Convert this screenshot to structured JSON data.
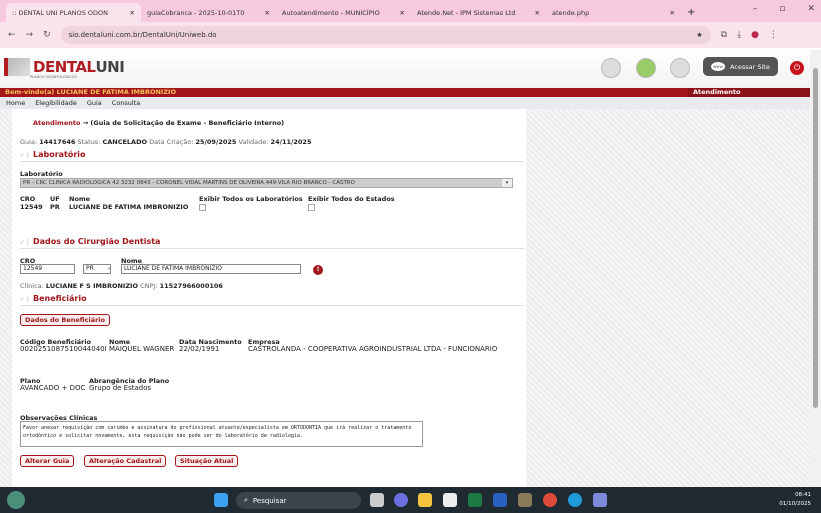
{
  "browser": {
    "tabs": [
      {
        "title": ":: DENTAL UNI PLANOS ODON",
        "active": true
      },
      {
        "title": "guiaCobranca - 2025-10-01T0",
        "active": false
      },
      {
        "title": "Autoatendimento - MUNICÍPIO",
        "active": false
      },
      {
        "title": "Atende.Net - IPM Sistemas Ltd",
        "active": false
      },
      {
        "title": "atende.php",
        "active": false
      }
    ],
    "url": "sio.dentaluni.com.br/DentalUni/Uniweb.do"
  },
  "header": {
    "logo_text": "DENTALUNI",
    "logo_sub": "PLANOS ODONTOLÓGICOS",
    "site_button": "Acessar Site",
    "welcome": "Bem-vindo(a) LUCIANE DE FATIMA IMBRONIZIO",
    "area": "Atendimento"
  },
  "menu": [
    "Home",
    "Elegibilidade",
    "Guia",
    "Consulta"
  ],
  "breadcrumb": {
    "root": "Atendimento",
    "arrow": "→",
    "current": "(Guia de Solicitação de Exame - Beneficiário Interno)"
  },
  "guia": {
    "guia_label": "Guia:",
    "guia": "14417646",
    "status_label": "Status:",
    "status": "CANCELADO",
    "criacao_label": "Data Criação:",
    "criacao": "25/09/2025",
    "validade_label": "Validade:",
    "validade": "24/11/2025"
  },
  "laboratorio": {
    "section": "Laboratório",
    "label": "Laboratório",
    "selected": "PR - CRC CLINICA RADIOLOGICA 42 3232 0843 - CORONEL VIDAL MARTINS DE OLIVEIRA,449-VILA RIO BRANCO - CASTRO",
    "cro_label": "CRO",
    "cro": "12549",
    "uf_label": "UF",
    "uf": "PR",
    "nome_label": "Nome",
    "nome": "LUCIANE DE FATIMA IMBRONIZIO",
    "todos_lab": "Exibir Todos os Laboratórios",
    "todos_estados": "Exibir Todos do Estados"
  },
  "dentista": {
    "section": "Dados do Cirurgião Dentista",
    "cro_label": "CRO",
    "cro": "12549",
    "uf": "PR",
    "nome_label": "Nome",
    "nome": "LUCIANE DE FATIMA IMBRONIZIO",
    "clinica_label": "Clínica:",
    "clinica": "LUCIANE F S IMBRONIZIO",
    "cnpj_label": "CNPJ:",
    "cnpj": "11527966000106"
  },
  "beneficiario": {
    "section": "Beneficiário",
    "dados_button": "Dados do Beneficiário",
    "codigo_label": "Código Beneficiário",
    "codigo": "0020251087510044040I",
    "nome_label": "Nome",
    "nome": "MAIQUEL WAGNER",
    "nasc_label": "Data Nascimento",
    "nasc": "22/02/1991",
    "empresa_label": "Empresa",
    "empresa": "CASTROLANDA - COOPERATIVA AGROINDUSTRIAL LTDA - FUNCIONARIO",
    "plano_label": "Plano",
    "plano": "AVANCADO + DOC",
    "abrangencia_label": "Abrangência do Plano",
    "abrangencia": "Grupo de Estados"
  },
  "observacoes": {
    "label": "Observações Clínicas",
    "text": "Favor anexar requisição com carimbo e assinatura do profissional atuante/especialista em ORTODONTIA que irá realizar o tratamento ortodôntico e solicitar novamente, esta requisição não pode ser do laboratório de radiologia."
  },
  "actions": {
    "alterar": "Alterar Guia",
    "cadastral": "Alteração Cadastral",
    "situacao": "Situação Atual"
  },
  "taskbar": {
    "search": "Pesquisar",
    "time": "08:41",
    "date": "01/10/2025"
  }
}
